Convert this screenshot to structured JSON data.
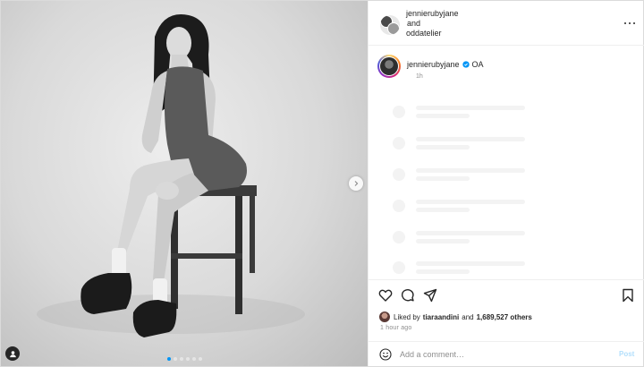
{
  "header": {
    "users": [
      "jennierubyjane",
      "and",
      "oddatelier"
    ],
    "more_icon": "more-horizontal-icon"
  },
  "media": {
    "description_icon": "photo",
    "slide_count": 6,
    "active_slide": 1,
    "next_icon": "chevron-right-icon",
    "tag_icon": "user-tag-icon"
  },
  "caption": {
    "username": "jennierubyjane",
    "text": "OA",
    "time": "1h",
    "verified": true
  },
  "actions": {
    "icons": [
      "heart-icon",
      "comment-icon",
      "share-icon",
      "bookmark-icon"
    ]
  },
  "likes": {
    "prefix": "Liked by",
    "user": "tiaraandini",
    "joiner": "and",
    "count": "1,689,527 others"
  },
  "timestamp": "1 hour ago",
  "comment": {
    "placeholder": "Add a comment…",
    "post_label": "Post"
  },
  "colors": {
    "accent": "#0095f6",
    "verified": "#0095f6",
    "post_disabled": "#b2dffc"
  }
}
